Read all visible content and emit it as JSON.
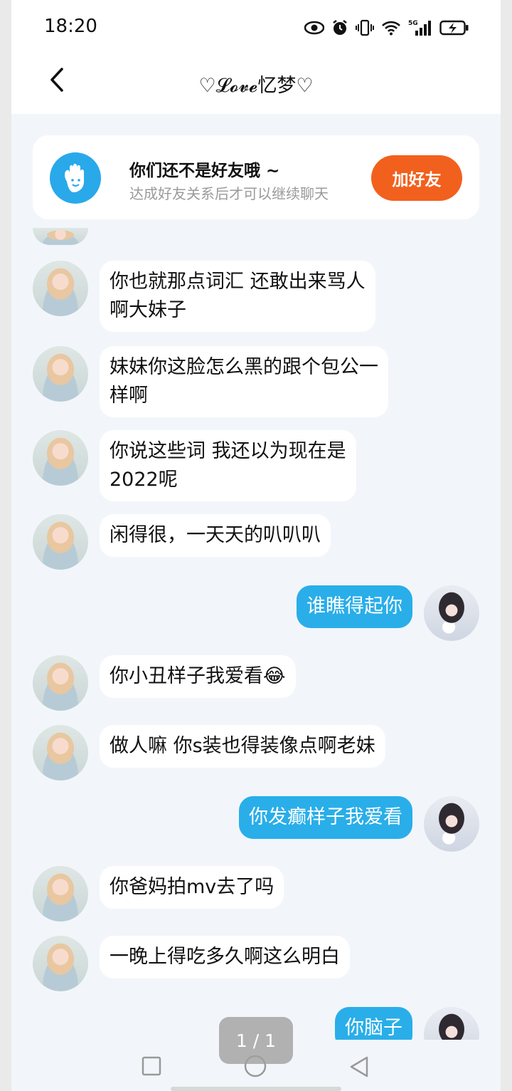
{
  "status_bar": {
    "time": "18:20",
    "icons": [
      "eye-icon",
      "alarm-icon",
      "vibrate-icon",
      "wifi-icon",
      "signal-5g-icon",
      "battery-charging-icon"
    ],
    "network_label": "5G"
  },
  "header": {
    "title": "♡𝓛𝓸𝓿𝓮忆梦♡",
    "back_icon": "chevron-left-icon"
  },
  "friend_banner": {
    "icon": "wave-hand-icon",
    "title": "你们还不是好友哦 ~",
    "subtitle": "达成好友关系后才可以继续聊天",
    "button_label": "加好友",
    "button_color": "#f2601e"
  },
  "messages": [
    {
      "sender": "peer",
      "lines": [
        "你也就那点词汇 还敢出来骂人",
        "啊大妹子"
      ]
    },
    {
      "sender": "peer",
      "lines": [
        "妹妹你这脸怎么黑的跟个包公一",
        "样啊"
      ]
    },
    {
      "sender": "peer",
      "lines": [
        "你说这些词 我还以为现在是",
        "2022呢"
      ]
    },
    {
      "sender": "peer",
      "lines": [
        "闲得很，一天天的叭叭叭"
      ]
    },
    {
      "sender": "self",
      "lines": [
        "谁瞧得起你"
      ]
    },
    {
      "sender": "peer",
      "lines": [
        "你小丑样子我爱看😂"
      ]
    },
    {
      "sender": "peer",
      "lines": [
        "做人嘛 你s装也得装像点啊老妹"
      ]
    },
    {
      "sender": "self",
      "lines": [
        "你发癫样子我爱看"
      ]
    },
    {
      "sender": "peer",
      "lines": [
        "你爸妈拍mv去了吗"
      ]
    },
    {
      "sender": "peer",
      "lines": [
        "一晚上得吃多久啊这么明白"
      ]
    },
    {
      "sender": "self",
      "lines": [
        "你脑子"
      ]
    }
  ],
  "page_indicator": "1 / 1",
  "nav": {
    "recents_icon": "square-icon",
    "home_icon": "circle-icon",
    "back_icon": "triangle-back-icon"
  },
  "colors": {
    "self_bubble": "#29aee9",
    "peer_bubble": "#ffffff",
    "chat_background": "#f2f6fa"
  }
}
